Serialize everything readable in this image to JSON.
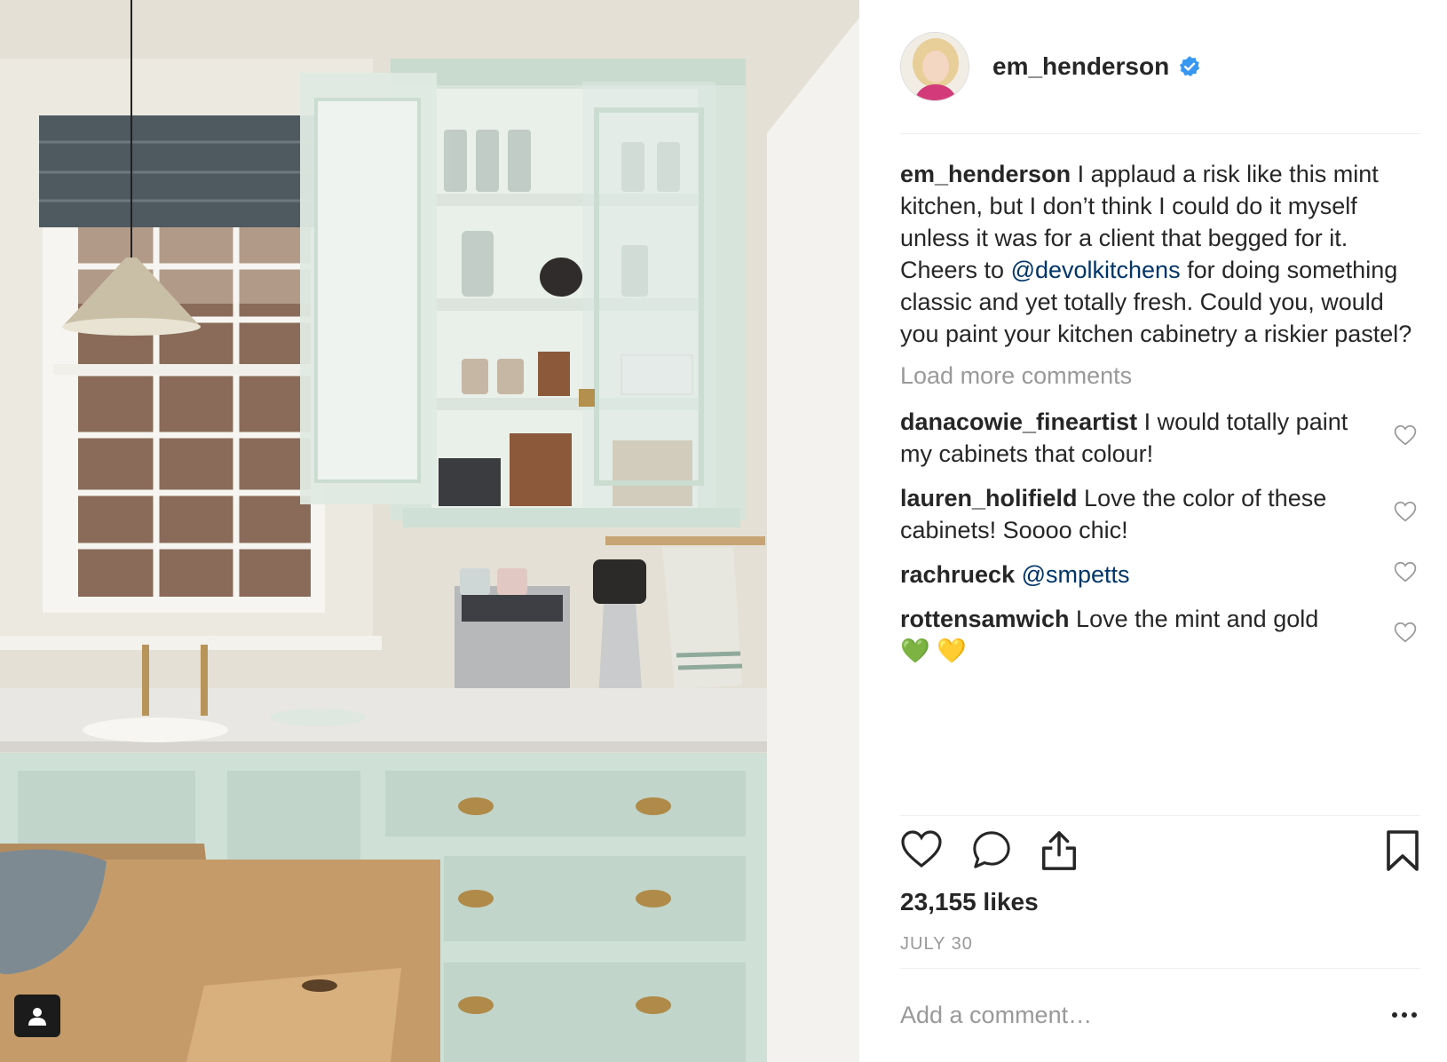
{
  "post": {
    "author": {
      "username": "em_henderson",
      "verified": true
    },
    "caption": {
      "username": "em_henderson",
      "text_before": " I applaud a risk like this mint kitchen, but I don’t think I could do it myself unless it was for a client that begged for it. Cheers to ",
      "mention": "@devolkitchens",
      "text_after": " for doing something classic and yet totally fresh. Could you, would you paint your kitchen cabinetry a riskier pastel?"
    },
    "load_more_label": "Load more comments",
    "comments": [
      {
        "username": "danacowie_fineartist",
        "text": " I would totally paint my cabinets that colour!"
      },
      {
        "username": "lauren_holifield",
        "text": " Love the color of these cabinets! Soooo chic!"
      },
      {
        "username": "rachrueck",
        "mention": "@smpetts"
      },
      {
        "username": "rottensamwich",
        "text": " Love the mint and gold",
        "emoji": "💚 💛"
      }
    ],
    "likes_label": "23,155 likes",
    "date_label": "JULY 30",
    "add_comment_placeholder": "Add a comment…"
  },
  "icons": {
    "like": "heart-outline-icon",
    "comment": "speech-bubble-icon",
    "share": "share-upload-icon",
    "save": "bookmark-icon",
    "more": "more-dots-icon",
    "tagged_user": "user-tag-icon",
    "verified": "verified-badge-icon"
  },
  "colors": {
    "text": "#262626",
    "secondary_text": "#999999",
    "mention": "#003569",
    "verified": "#3897f0",
    "divider": "#efefef",
    "cabinet_mint": "#cfe0d7"
  }
}
